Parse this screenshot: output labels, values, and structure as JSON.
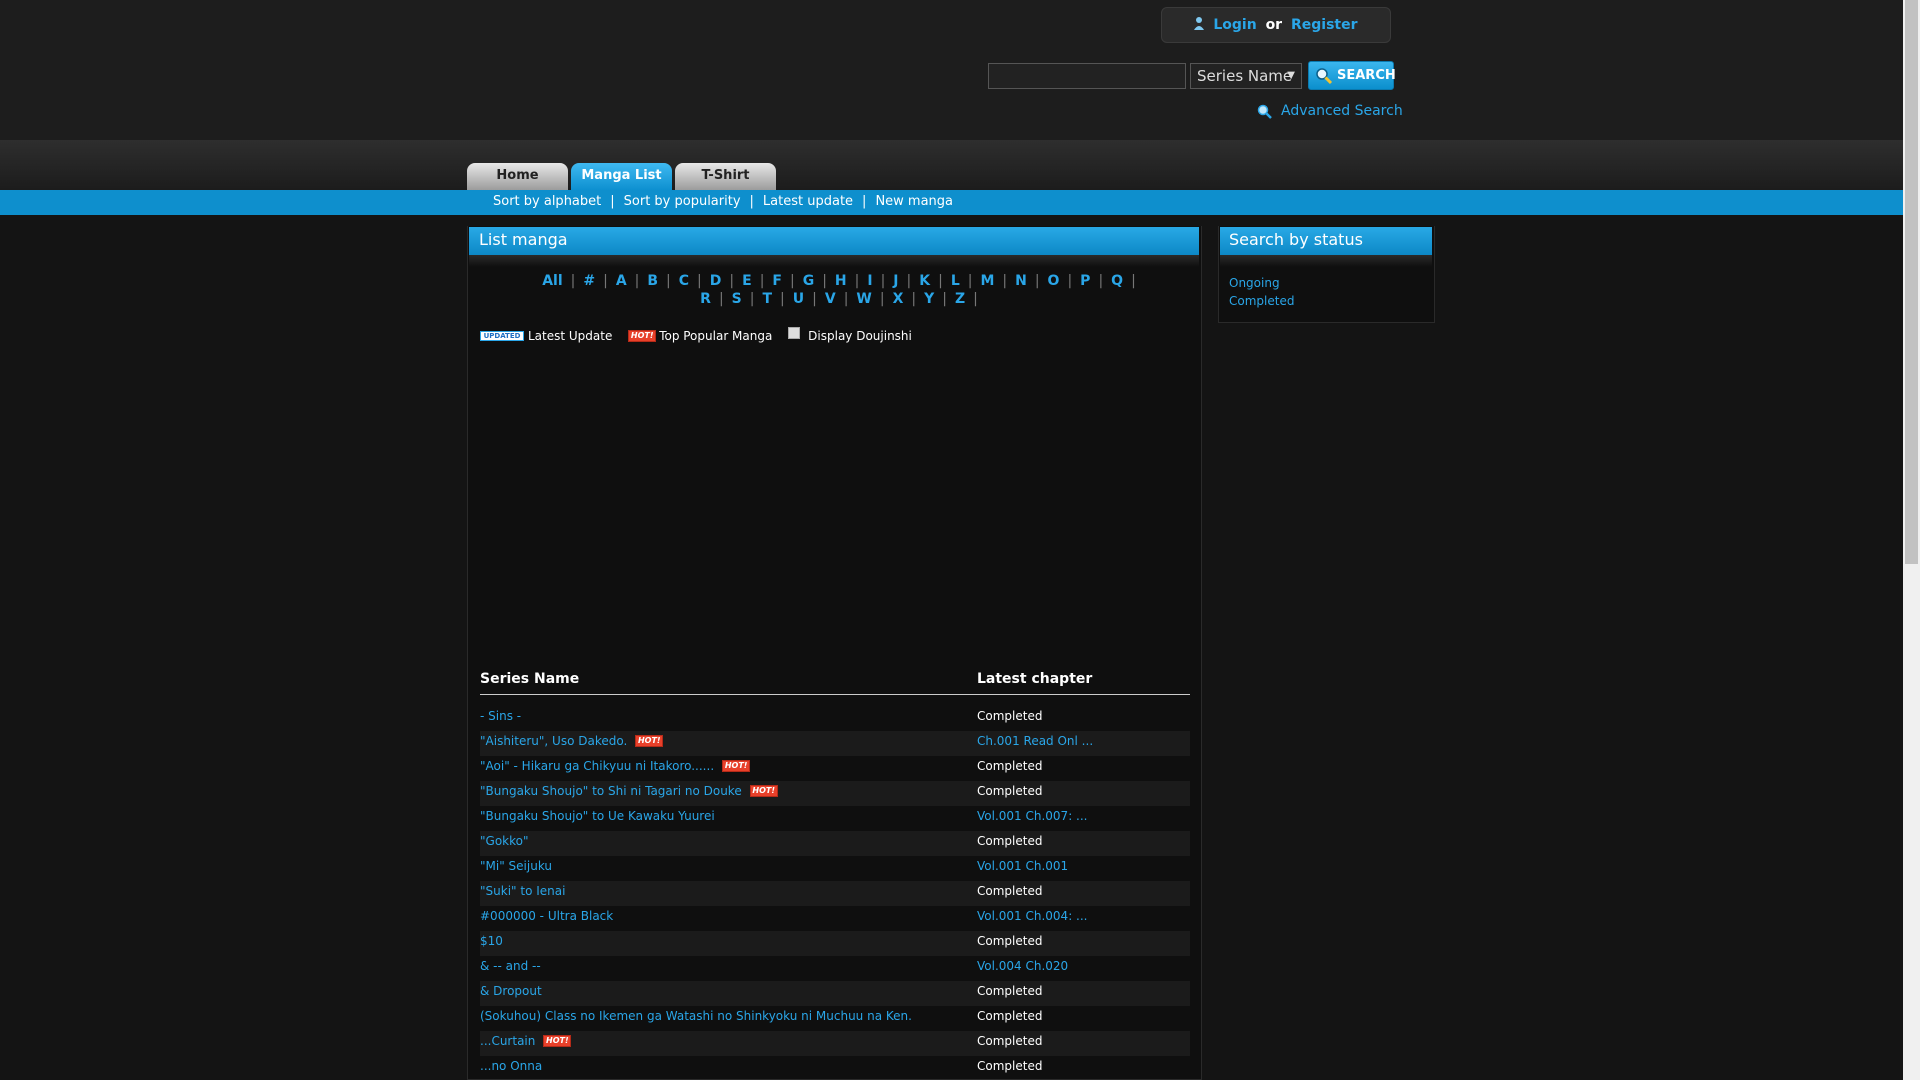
{
  "header": {
    "login_label": "Login",
    "or_label": "or",
    "register_label": "Register",
    "search_placeholder": "",
    "search_type": "Series Name",
    "search_button": "SEARCH",
    "advanced_search": "Advanced Search"
  },
  "tabs": [
    {
      "label": "Home"
    },
    {
      "label": "Manga List"
    },
    {
      "label": "T-Shirt"
    }
  ],
  "subnav": [
    "Sort by alphabet",
    "Sort by popularity",
    "Latest update",
    "New manga"
  ],
  "list": {
    "title": "List manga",
    "letters_row1": [
      "All",
      "#",
      "A",
      "B",
      "C",
      "D",
      "E",
      "F",
      "G",
      "H",
      "I",
      "J",
      "K",
      "L",
      "M",
      "N",
      "O",
      "P",
      "Q"
    ],
    "letters_row2": [
      "R",
      "S",
      "T",
      "U",
      "V",
      "W",
      "X",
      "Y",
      "Z"
    ],
    "legend": {
      "updated_badge": "UPDATED",
      "latest_update": "Latest Update",
      "hot_badge": "HOT!",
      "top_popular": "Top Popular Manga",
      "display_doujinshi": "Display Doujinshi"
    },
    "col_series": "Series Name",
    "col_chapter": "Latest chapter",
    "rows": [
      {
        "name": "- Sins -",
        "chapter": "Completed",
        "hot": false
      },
      {
        "name": "\"Aishiteru\", Uso Dakedo.",
        "chapter": "Ch.001 Read Onl ...",
        "hot": true
      },
      {
        "name": "\"Aoi\" - Hikaru ga Chikyuu ni Itakoro......",
        "chapter": "Completed",
        "hot": true
      },
      {
        "name": "\"Bungaku Shoujo\" to Shi ni Tagari no Douke",
        "chapter": "Completed",
        "hot": true
      },
      {
        "name": "\"Bungaku Shoujo\" to Ue Kawaku Yuurei",
        "chapter": "Vol.001 Ch.007: ...",
        "hot": false
      },
      {
        "name": "\"Gokko\"",
        "chapter": "Completed",
        "hot": false
      },
      {
        "name": "\"Mi\" Seijuku",
        "chapter": "Vol.001 Ch.001",
        "hot": false
      },
      {
        "name": "\"Suki\" to Ienai",
        "chapter": "Completed",
        "hot": false
      },
      {
        "name": "#000000 - Ultra Black",
        "chapter": "Vol.001 Ch.004: ...",
        "hot": false
      },
      {
        "name": "$10",
        "chapter": "Completed",
        "hot": false
      },
      {
        "name": "& -- and --",
        "chapter": "Vol.004 Ch.020",
        "hot": false
      },
      {
        "name": "& Dropout",
        "chapter": "Completed",
        "hot": false
      },
      {
        "name": "(Sokuhou) Class no Ikemen ga Watashi no Shinkyoku ni Muchuu na Ken.",
        "chapter": "Completed",
        "hot": false
      },
      {
        "name": "...Curtain",
        "chapter": "Completed",
        "hot": true
      },
      {
        "name": "...no Onna",
        "chapter": "Completed",
        "hot": false
      }
    ]
  },
  "status": {
    "title": "Search by status",
    "ongoing": "Ongoing",
    "completed": "Completed"
  },
  "colors": {
    "accent": "#0e8fcd",
    "link": "#2aa6e8",
    "hot": "#e8402a",
    "background": "#141414"
  }
}
